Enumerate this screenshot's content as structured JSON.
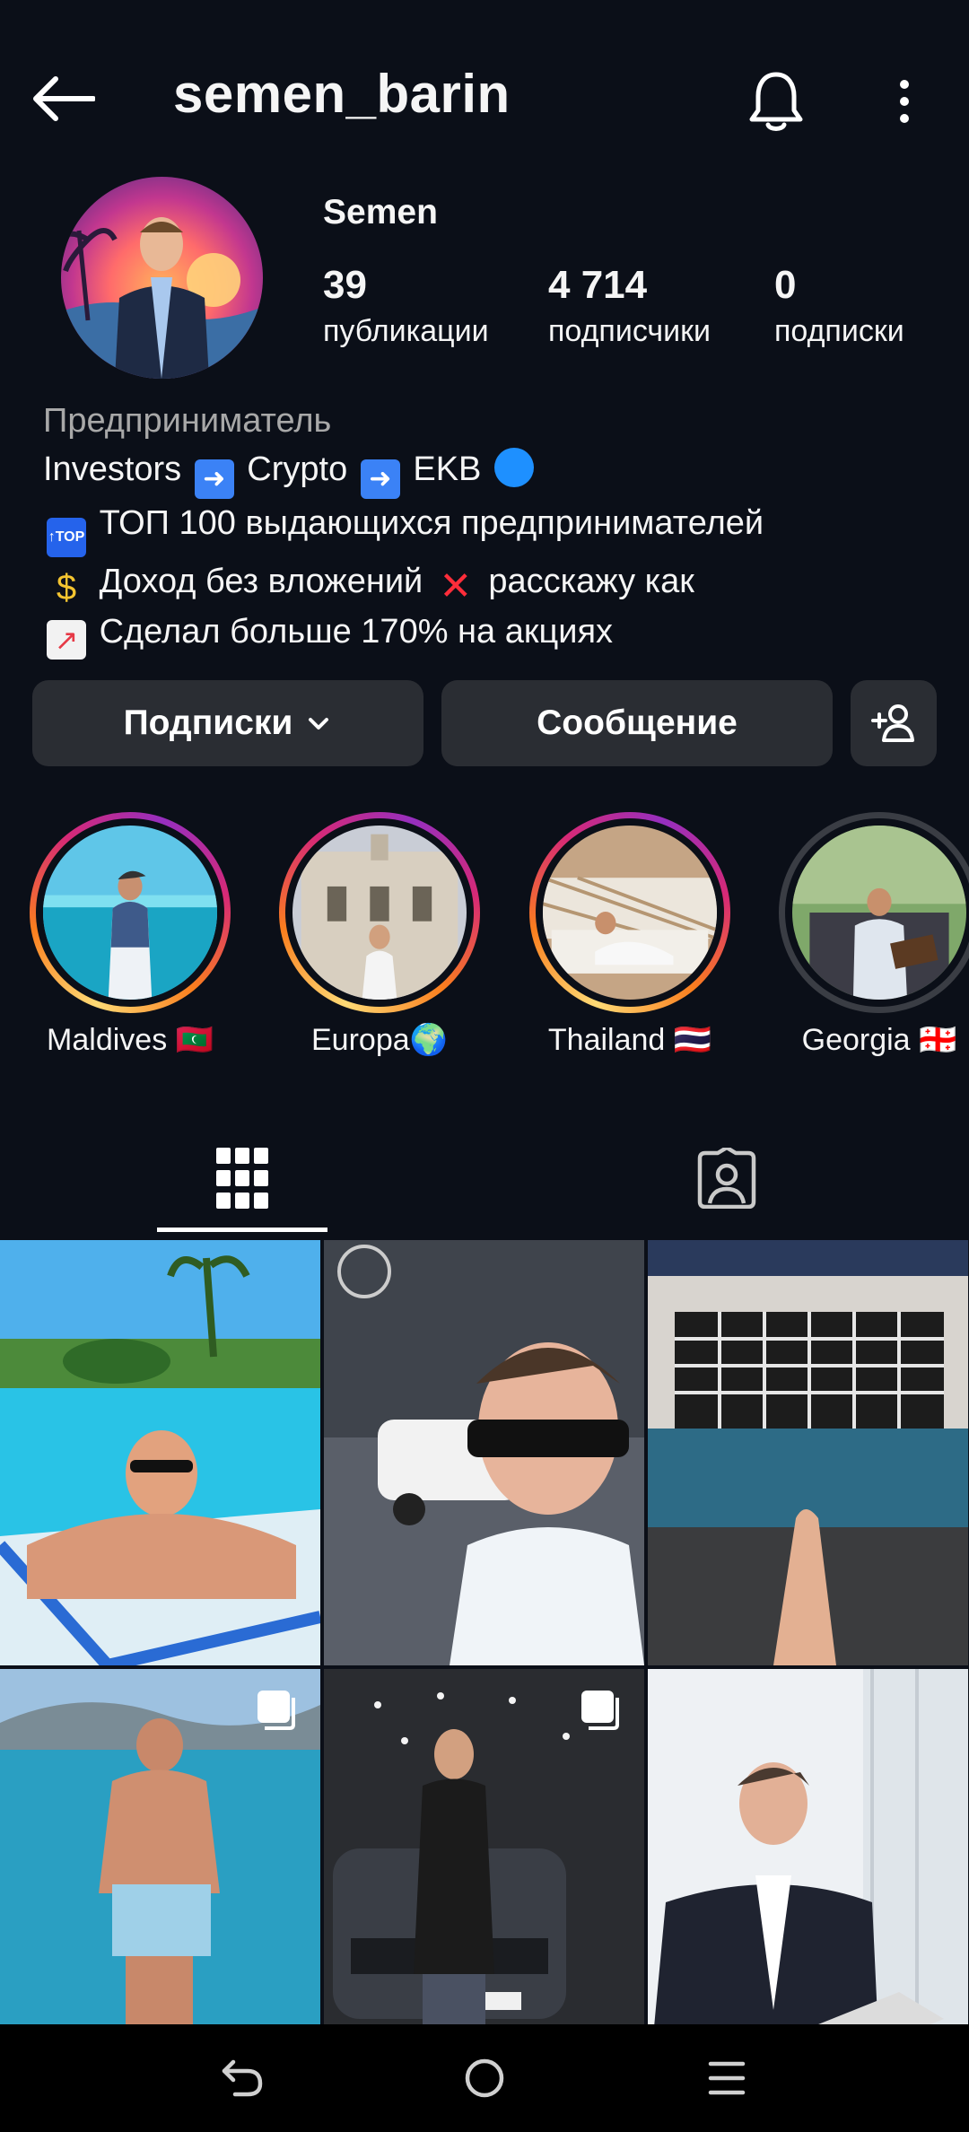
{
  "header": {
    "username": "semen_barin"
  },
  "profile": {
    "display_name": "Semen",
    "stats": [
      {
        "value": "39",
        "label": "публикации"
      },
      {
        "value": "4 714",
        "label": "подписчики"
      },
      {
        "value": "0",
        "label": "подписки"
      }
    ]
  },
  "bio": {
    "category": "Предприниматель",
    "line1_a": "Investors",
    "line1_b": "Crypto",
    "line1_c": "EKB",
    "line2": "ТОП 100 выдающихся предпринимателей",
    "line3_a": "Доход без вложений",
    "line3_b": "расскажу как",
    "line4": "Сделал больше 170% на акциях"
  },
  "actions": {
    "following_label": "Подписки",
    "message_label": "Сообщение"
  },
  "highlights": [
    {
      "label": "Maldives 🇲🇻"
    },
    {
      "label": "Europa🌍"
    },
    {
      "label": "Thailand 🇹🇭"
    },
    {
      "label": "Georgia 🇬🇪"
    }
  ],
  "tabs": {
    "grid_icon": "grid-icon",
    "tagged_icon": "tagged-person-icon"
  },
  "colors": {
    "background": "#0b0f18",
    "button": "#2a2d33",
    "secondary_text": "#a8a8a8"
  }
}
